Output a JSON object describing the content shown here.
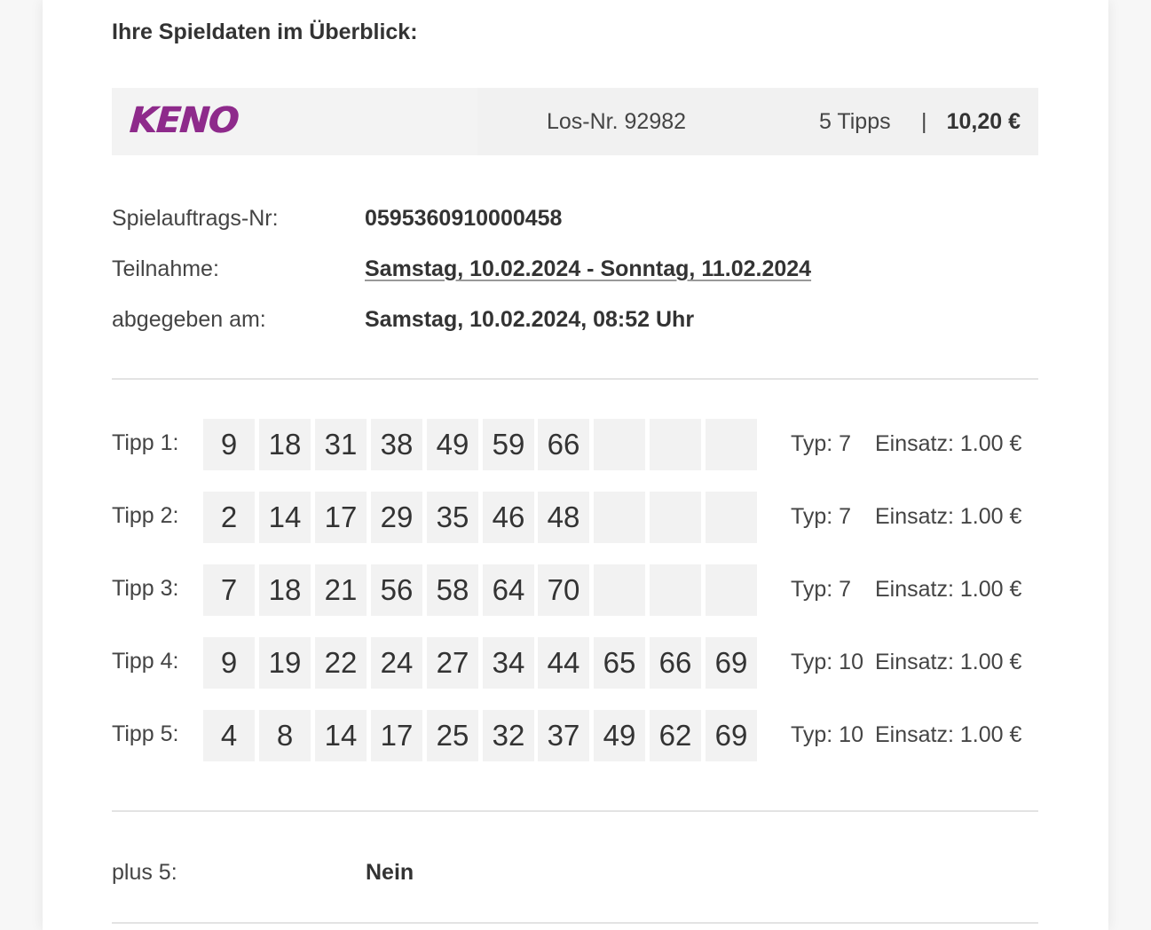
{
  "heading": "Ihre Spieldaten im Überblick:",
  "banner": {
    "logo": "KENO",
    "los_nr": "Los-Nr. 92982",
    "tipps": "5 Tipps",
    "separator": "|",
    "price": "10,20 €"
  },
  "info": {
    "auftrag_label": "Spielauftrags-Nr:",
    "auftrag_value": "0595360910000458",
    "teilnahme_label": "Teilnahme:",
    "teilnahme_value": "Samstag, 10.02.2024 - Sonntag, 11.02.2024",
    "abgegeben_label": "abgegeben am:",
    "abgegeben_value": "Samstag, 10.02.2024, 08:52 Uhr"
  },
  "tipps": [
    {
      "label": "Tipp 1:",
      "numbers": [
        "9",
        "18",
        "31",
        "38",
        "49",
        "59",
        "66",
        "",
        "",
        ""
      ],
      "typ": "Typ: 7",
      "einsatz": "Einsatz: 1.00 €"
    },
    {
      "label": "Tipp 2:",
      "numbers": [
        "2",
        "14",
        "17",
        "29",
        "35",
        "46",
        "48",
        "",
        "",
        ""
      ],
      "typ": "Typ: 7",
      "einsatz": "Einsatz: 1.00 €"
    },
    {
      "label": "Tipp 3:",
      "numbers": [
        "7",
        "18",
        "21",
        "56",
        "58",
        "64",
        "70",
        "",
        "",
        ""
      ],
      "typ": "Typ: 7",
      "einsatz": "Einsatz: 1.00 €"
    },
    {
      "label": "Tipp 4:",
      "numbers": [
        "9",
        "19",
        "22",
        "24",
        "27",
        "34",
        "44",
        "65",
        "66",
        "69"
      ],
      "typ": "Typ: 10",
      "einsatz": "Einsatz: 1.00 €"
    },
    {
      "label": "Tipp 5:",
      "numbers": [
        "4",
        "8",
        "14",
        "17",
        "25",
        "32",
        "37",
        "49",
        "62",
        "69"
      ],
      "typ": "Typ: 10",
      "einsatz": "Einsatz: 1.00 €"
    }
  ],
  "plus5": {
    "label": "plus 5:",
    "value": "Nein"
  },
  "colors": {
    "brand": "#8e2a8b",
    "cell_bg": "#f2f2f2",
    "banner_bg": "#f3f3f3"
  }
}
